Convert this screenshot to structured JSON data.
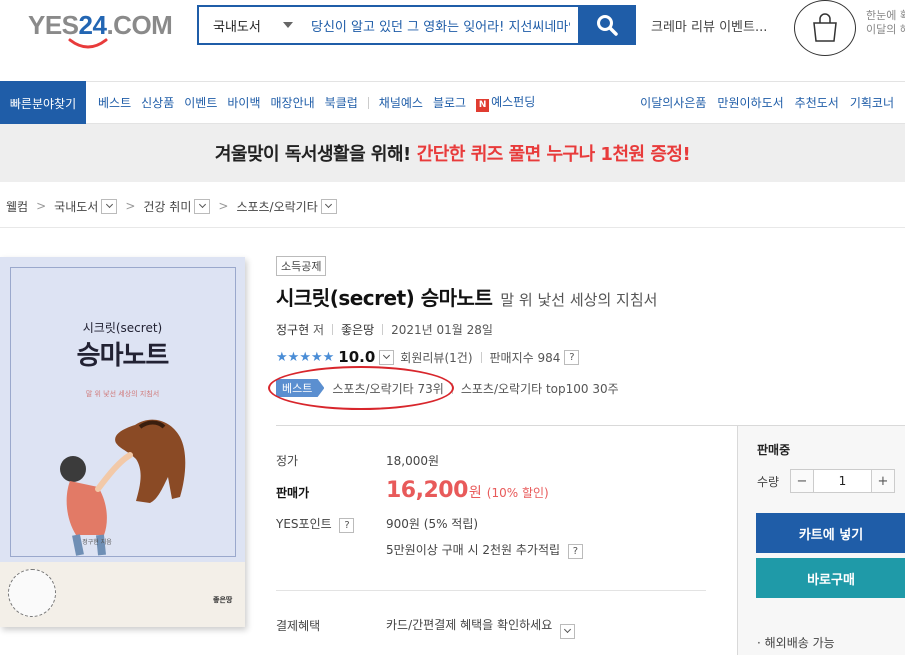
{
  "header": {
    "logo_left": "YES",
    "logo_num": "24",
    "logo_right": ".COM",
    "search_category": "국내도서",
    "search_value": "당신이 알고 있던 그 영화는 잊어라! 지선씨네마인드",
    "review_text": "크레마 리뷰 이벤트...",
    "side_line1": "한눈에 확",
    "side_line2": "이달의 혜"
  },
  "nav": {
    "quick": "빠른분야찾기",
    "items": [
      "베스트",
      "신상품",
      "이벤트",
      "바이백",
      "매장안내",
      "북클럽",
      "채널예스",
      "블로그",
      "예스펀딩"
    ],
    "n_badge": "N",
    "right_items": [
      "이달의사은품",
      "만원이하도서",
      "추천도서",
      "기획코너"
    ]
  },
  "banner": {
    "text": "겨울맞이 독서생활을 위해!",
    "highlight": "간단한 퀴즈 풀면 누구나 1천원 증정!"
  },
  "breadcrumb": [
    "웰컴",
    "국내도서",
    "건강 취미",
    "스포츠/오락기타"
  ],
  "cover": {
    "subtitle": "시크릿(secret)",
    "title": "승마노트",
    "tagline": "말 위 낯선 세상의 지침서",
    "author": "정구현 지음",
    "publisher": "좋은땅"
  },
  "product": {
    "tag": "소득공제",
    "title": "시크릿(secret) 승마노트",
    "subtitle": "말 위 낯선 세상의 지침서",
    "author": "정구현",
    "author_suffix": "저",
    "publisher": "좋은땅",
    "date": "2021년 01월 28일",
    "score": "10.0",
    "review_count": "회원리뷰(1건)",
    "sales_index": "판매지수 984",
    "qmark": "?",
    "best_badge": "베스트",
    "best_rank1": "스포츠/오락기타 73위",
    "best_rank2": "스포츠/오락기타 top100 30주"
  },
  "price": {
    "list_label": "정가",
    "list_value": "18,000원",
    "sale_label": "판매가",
    "sale_value": "16,200",
    "sale_won": "원",
    "discount": "(10% 할인)",
    "point_label": "YES포인트",
    "point_value": "900원 (5% 적립)",
    "point_extra": "5만원이상 구매 시 2천원 추가적립",
    "benefit_label": "결제혜택",
    "benefit_value": "카드/간편결제 혜택을 확인하세요"
  },
  "buy": {
    "status": "판매중",
    "qty_label": "수량",
    "minus": "−",
    "qty": "1",
    "plus": "+",
    "cart": "카트에 넣기",
    "buy_now": "바로구매",
    "overseas": "· 해외배송 가능"
  }
}
